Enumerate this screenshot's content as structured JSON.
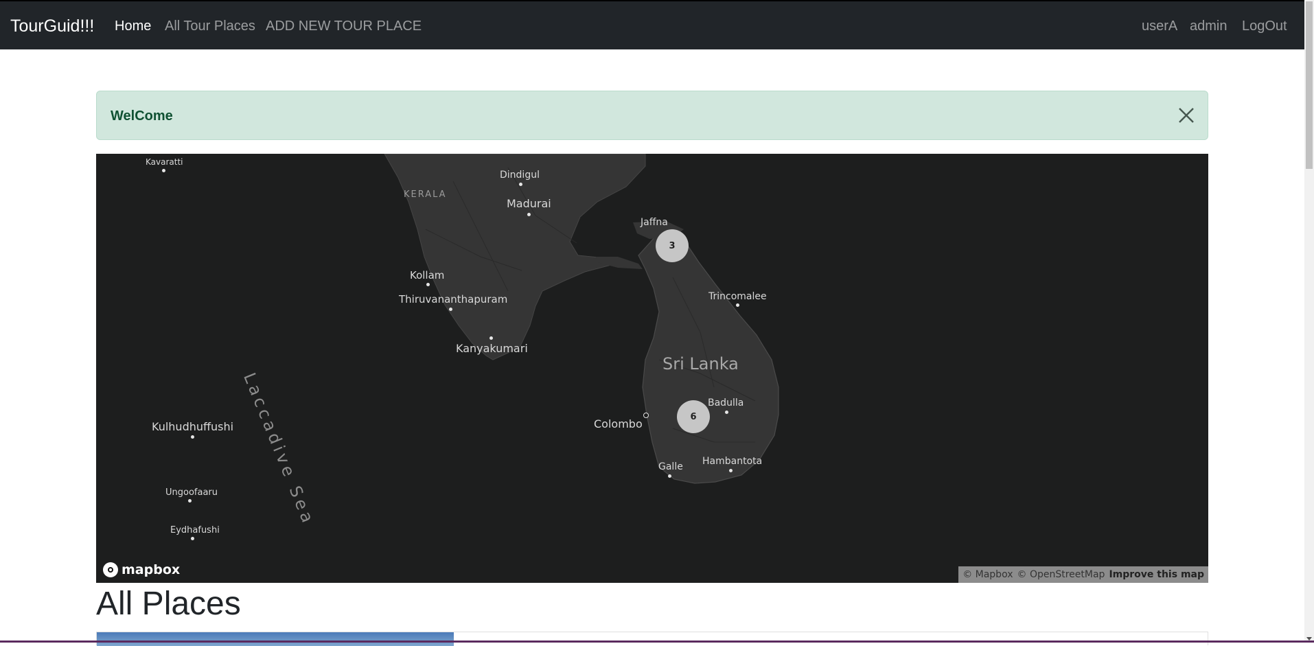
{
  "navbar": {
    "brand": "TourGuid!!!",
    "links": [
      {
        "label": "Home",
        "active": true
      },
      {
        "label": "All Tour Places",
        "active": false
      },
      {
        "label": "ADD NEW TOUR PLACE",
        "active": false
      }
    ],
    "right_links": [
      {
        "label": "userA"
      },
      {
        "label": "admin"
      },
      {
        "label": "LogOut"
      }
    ]
  },
  "alert": {
    "message": "WelCome",
    "close_icon": "close-icon"
  },
  "map": {
    "labels": {
      "kavaratti": "Kavaratti",
      "dindigul": "Dindigul",
      "kerala": "KERALA",
      "madurai": "Madurai",
      "jaffna": "Jaffna",
      "kollam": "Kollam",
      "thiruvananthapuram": "Thiruvananthapuram",
      "trincomalee": "Trincomalee",
      "kanyakumari": "Kanyakumari",
      "sri_lanka": "Sri Lanka",
      "laccadive_sea": "Laccadive Sea",
      "badulla": "Badulla",
      "colombo": "Colombo",
      "kulhudhuffushi": "Kulhudhuffushi",
      "hambantota": "Hambantota",
      "galle": "Galle",
      "ungoofaaru": "Ungoofaaru",
      "eydhafushi": "Eydhafushi"
    },
    "clusters": [
      {
        "name": "north",
        "count": "3"
      },
      {
        "name": "south",
        "count": "6"
      }
    ],
    "logo": "mapbox",
    "attribution": {
      "mapbox": "© Mapbox",
      "osm": "© OpenStreetMap",
      "improve": "Improve this map"
    },
    "colors": {
      "water": "#1d1e1e",
      "land": "#353535",
      "cluster": "#c6c6c6"
    }
  },
  "section": {
    "title": "All Places"
  }
}
